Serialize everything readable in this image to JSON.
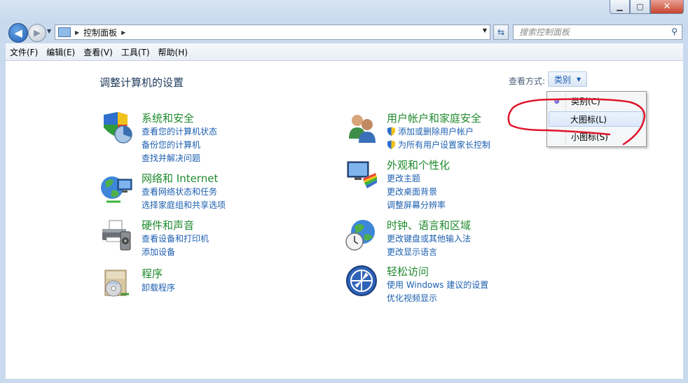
{
  "window": {
    "controls": {
      "minimize": "▁",
      "maximize": "▢",
      "close": "✕"
    }
  },
  "navbar": {
    "address": {
      "segments": [
        "控制面板"
      ]
    },
    "search": {
      "placeholder": "搜索控制面板"
    }
  },
  "menubar": {
    "items": [
      "文件(F)",
      "编辑(E)",
      "查看(V)",
      "工具(T)",
      "帮助(H)"
    ]
  },
  "content": {
    "title": "调整计算机的设置",
    "viewby": {
      "label": "查看方式:",
      "selected": "类别"
    },
    "categories": [
      {
        "title": "系统和安全",
        "icon": "shield-chart-icon",
        "links": [
          "查看您的计算机状态",
          "备份您的计算机",
          "查找并解决问题"
        ]
      },
      {
        "title": "网络和 Internet",
        "icon": "network-globe-icon",
        "links": [
          "查看网络状态和任务",
          "选择家庭组和共享选项"
        ]
      },
      {
        "title": "硬件和声音",
        "icon": "printer-icon",
        "links": [
          "查看设备和打印机",
          "添加设备"
        ]
      },
      {
        "title": "程序",
        "icon": "programs-icon",
        "links": [
          "卸载程序"
        ]
      },
      {
        "title": "用户帐户和家庭安全",
        "icon": "users-icon",
        "links": [
          "添加或删除用户帐户",
          "为所有用户设置家长控制"
        ]
      },
      {
        "title": "外观和个性化",
        "icon": "monitor-palette-icon",
        "links": [
          "更改主题",
          "更改桌面背景",
          "调整屏幕分辨率"
        ]
      },
      {
        "title": "时钟、语言和区域",
        "icon": "globe-clock-icon",
        "links": [
          "更改键盘或其他输入法",
          "更改显示语言"
        ]
      },
      {
        "title": "轻松访问",
        "icon": "ease-of-access-icon",
        "links": [
          "使用 Windows 建议的设置",
          "优化视频显示"
        ]
      }
    ]
  },
  "dropdown": {
    "items": [
      {
        "label": "类别(C)",
        "selected": true
      },
      {
        "label": "大图标(L)",
        "hovered": true
      },
      {
        "label": "小图标(S)"
      }
    ]
  },
  "colors": {
    "link": "#1c5fb0",
    "category_title": "#1f8a2e",
    "title": "#1e395b",
    "annotation": "#e0142a"
  }
}
